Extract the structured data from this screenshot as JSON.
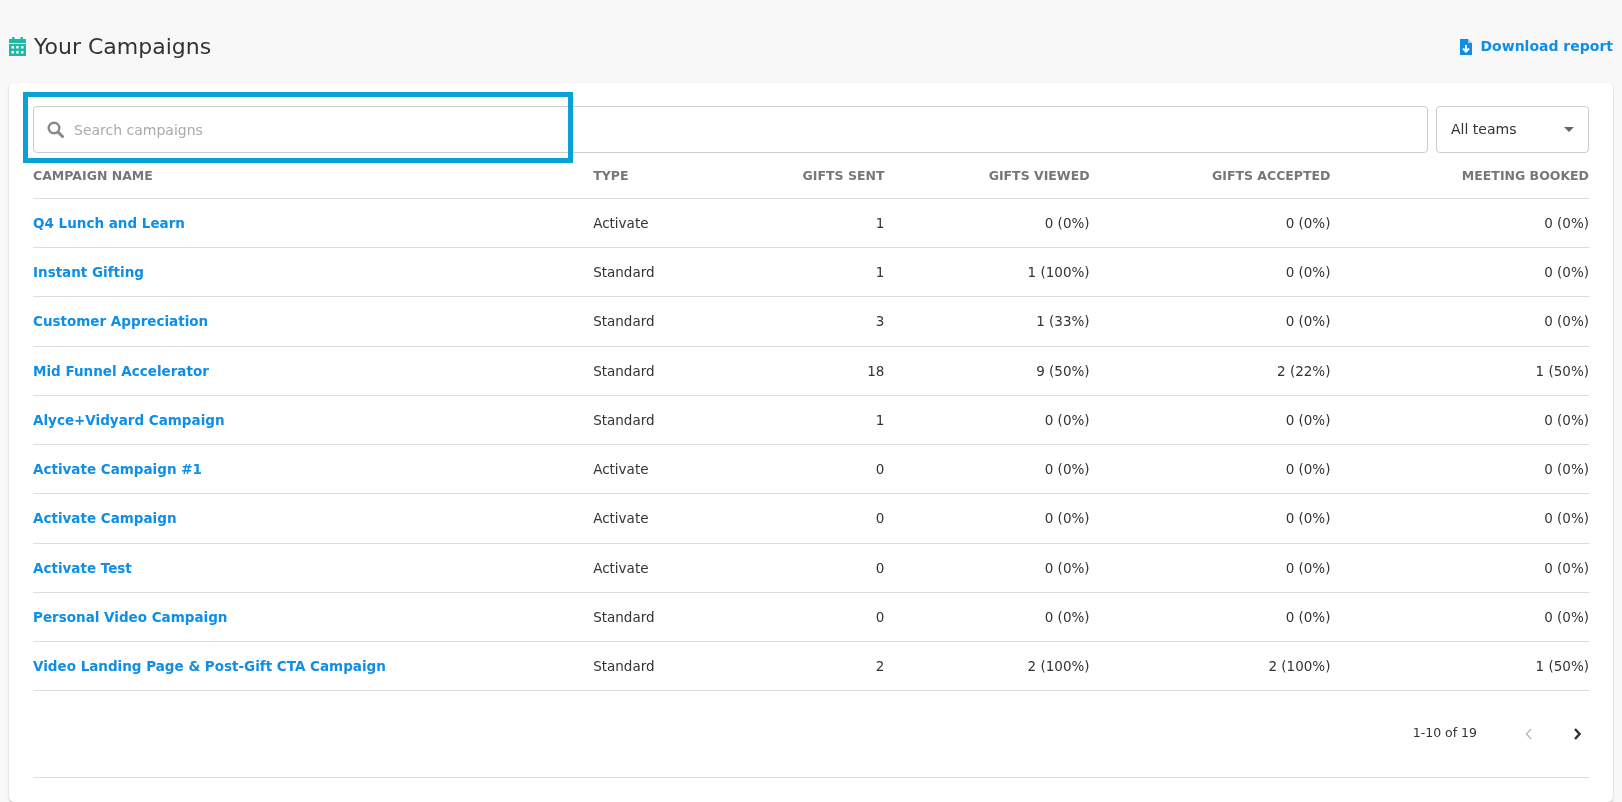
{
  "header": {
    "title": "Your Campaigns",
    "download_link": "Download report"
  },
  "search": {
    "placeholder": "Search campaigns",
    "highlighted": true
  },
  "team_filter": {
    "value": "All teams"
  },
  "table": {
    "columns": [
      "CAMPAIGN NAME",
      "TYPE",
      "GIFTS SENT",
      "GIFTS VIEWED",
      "GIFTS ACCEPTED",
      "MEETING BOOKED"
    ],
    "rows": [
      [
        "Q4 Lunch and Learn",
        "Activate",
        "1",
        "0 (0%)",
        "0 (0%)",
        "0 (0%)"
      ],
      [
        "Instant Gifting",
        "Standard",
        "1",
        "1 (100%)",
        "0 (0%)",
        "0 (0%)"
      ],
      [
        "Customer Appreciation",
        "Standard",
        "3",
        "1 (33%)",
        "0 (0%)",
        "0 (0%)"
      ],
      [
        "Mid Funnel Accelerator",
        "Standard",
        "18",
        "9 (50%)",
        "2 (22%)",
        "1 (50%)"
      ],
      [
        "Alyce+Vidyard Campaign",
        "Standard",
        "1",
        "0 (0%)",
        "0 (0%)",
        "0 (0%)"
      ],
      [
        "Activate Campaign #1",
        "Activate",
        "0",
        "0 (0%)",
        "0 (0%)",
        "0 (0%)"
      ],
      [
        "Activate Campaign",
        "Activate",
        "0",
        "0 (0%)",
        "0 (0%)",
        "0 (0%)"
      ],
      [
        "Activate Test",
        "Activate",
        "0",
        "0 (0%)",
        "0 (0%)",
        "0 (0%)"
      ],
      [
        "Personal Video Campaign",
        "Standard",
        "0",
        "0 (0%)",
        "0 (0%)",
        "0 (0%)"
      ],
      [
        "Video Landing Page & Post-Gift CTA Campaign",
        "Standard",
        "2",
        "2 (100%)",
        "2 (100%)",
        "1 (50%)"
      ]
    ]
  },
  "pagination": {
    "range": "1-10 of 19",
    "prev_disabled": true,
    "next_disabled": false
  }
}
